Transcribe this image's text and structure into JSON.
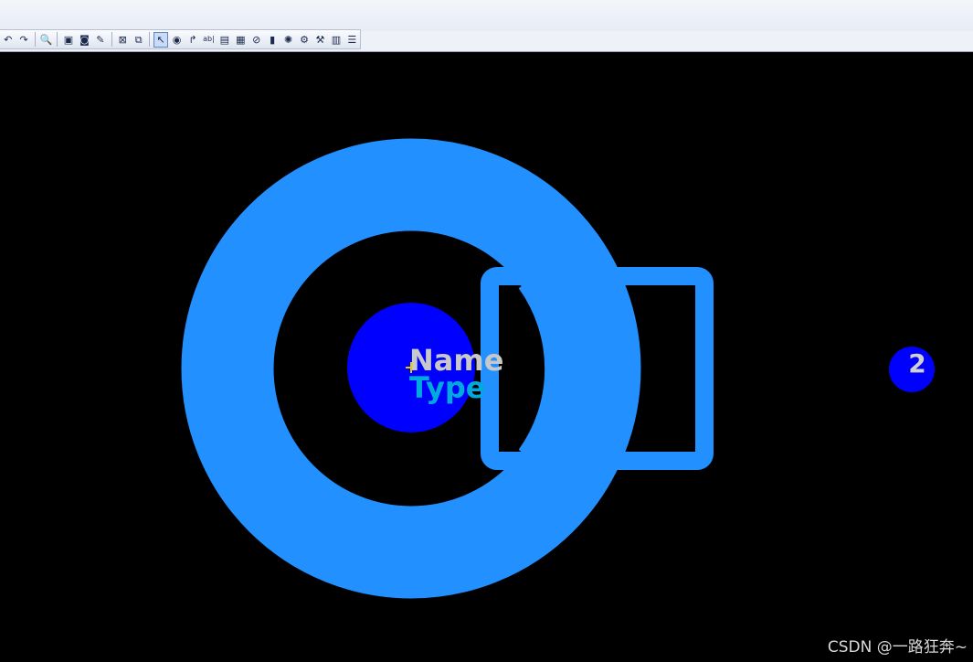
{
  "toolbar": {
    "buttons": [
      {
        "icon": "undo-icon",
        "glyph": "↶"
      },
      {
        "icon": "redo-icon",
        "glyph": "↷"
      },
      {
        "icon": "zoom-icon",
        "glyph": "🔍"
      },
      {
        "icon": "view-area-icon",
        "glyph": "▣"
      },
      {
        "icon": "layer-icon",
        "glyph": "◙"
      },
      {
        "icon": "brush-icon",
        "glyph": "✎"
      },
      {
        "icon": "place-icon",
        "glyph": "⊠"
      },
      {
        "icon": "window-icon",
        "glyph": "⧉"
      },
      {
        "icon": "select-arrow-icon",
        "glyph": "↖",
        "active": true
      },
      {
        "icon": "route-icon",
        "glyph": "◉"
      },
      {
        "icon": "pin-icon",
        "glyph": "↱"
      },
      {
        "icon": "text-icon",
        "glyph": "ab|"
      },
      {
        "icon": "component-icon",
        "glyph": "▤"
      },
      {
        "icon": "copper-icon",
        "glyph": "▦"
      },
      {
        "icon": "no-connect-icon",
        "glyph": "⊘"
      },
      {
        "icon": "library-icon",
        "glyph": "▮"
      },
      {
        "icon": "sun-icon",
        "glyph": "✺"
      },
      {
        "icon": "drc-icon",
        "glyph": "⚙"
      },
      {
        "icon": "settings-icon",
        "glyph": "⚒"
      },
      {
        "icon": "report-icon",
        "glyph": "▥"
      },
      {
        "icon": "list-icon",
        "glyph": "☰"
      }
    ]
  },
  "pcb": {
    "ref_label": "Name",
    "type_label": "Type",
    "pin_number": "2",
    "colors": {
      "background": "#000000",
      "pad_copper": "#2290ff",
      "pad_hole": "#0000ff",
      "name_text": "#c8c8c8",
      "type_text": "#00aadd",
      "pin_text": "#d0d0d0"
    }
  },
  "watermark": "CSDN @一路狂奔~"
}
